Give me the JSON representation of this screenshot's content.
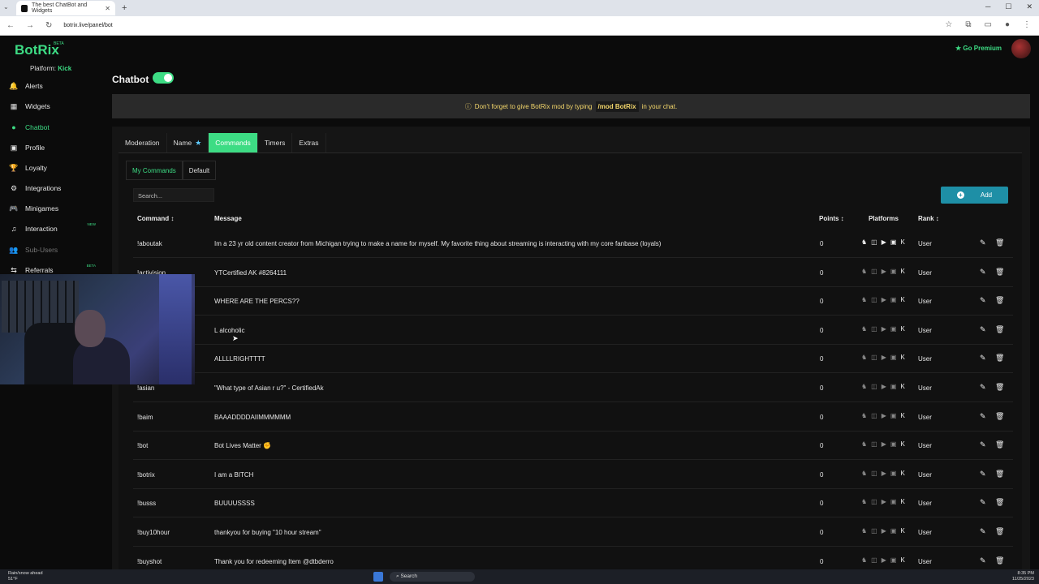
{
  "browser": {
    "tab_title": "The best ChatBot and Widgets",
    "url": "botrix.live/panel/bot"
  },
  "header": {
    "logo": "BotRix",
    "beta": "BETA",
    "platform_label": "Platform:",
    "platform_value": "Kick",
    "go_premium": "Go Premium"
  },
  "sidebar": {
    "items": [
      {
        "label": "Alerts",
        "icon": "bell-icon",
        "glyph": "🔔"
      },
      {
        "label": "Widgets",
        "icon": "widgets-icon",
        "glyph": "▦"
      },
      {
        "label": "Chatbot",
        "icon": "robot-icon",
        "glyph": "●"
      },
      {
        "label": "Profile",
        "icon": "profile-icon",
        "glyph": "▣"
      },
      {
        "label": "Loyalty",
        "icon": "trophy-icon",
        "glyph": "🏆"
      },
      {
        "label": "Integrations",
        "icon": "plug-icon",
        "glyph": "⚙"
      },
      {
        "label": "Minigames",
        "icon": "gamepad-icon",
        "glyph": "🎮"
      },
      {
        "label": "Interaction",
        "icon": "music-icon",
        "glyph": "♫",
        "tag": "NEW"
      },
      {
        "label": "Sub-Users",
        "icon": "users-icon",
        "glyph": "👥"
      },
      {
        "label": "Referrals",
        "icon": "link-icon",
        "glyph": "⇆",
        "tag": "BETA"
      }
    ]
  },
  "main": {
    "title": "Chatbot",
    "notice_prefix": "Don't forget to give BotRix mod by typing",
    "notice_cmd": "/mod BotRix",
    "notice_suffix": "in your chat.",
    "tabs": [
      {
        "label": "Moderation"
      },
      {
        "label": "Name",
        "star": "★"
      },
      {
        "label": "Commands"
      },
      {
        "label": "Timers"
      },
      {
        "label": "Extras"
      }
    ],
    "subtabs": [
      "My Commands",
      "Default"
    ],
    "search_placeholder": "Search...",
    "add_label": "Add",
    "columns": {
      "command": "Command ↕",
      "message": "Message",
      "points": "Points ↕",
      "platforms": "Platforms",
      "rank": "Rank ↕"
    },
    "rows": [
      {
        "command": "!aboutak",
        "message": "Im a 23 yr old content creator from Michigan trying to make a name for myself. My favorite thing about streaming is interacting with my core fanbase (loyals)",
        "points": "0",
        "rank": "User"
      },
      {
        "command": "!activision",
        "message": "YTCertified AK #8264111",
        "points": "0",
        "rank": "User"
      },
      {
        "command": "",
        "message": "WHERE ARE THE PERCS??",
        "points": "0",
        "rank": "User"
      },
      {
        "command": "",
        "message": "L alcoholic",
        "points": "0",
        "rank": "User"
      },
      {
        "command": "",
        "message": "ALLLLRIGHTTTT",
        "points": "0",
        "rank": "User"
      },
      {
        "command": "!asian",
        "message": "\"What type of Asian r u?\" - CertifiedAk",
        "points": "0",
        "rank": "User"
      },
      {
        "command": "!baim",
        "message": "BAAADDDDAIIMMMMMM",
        "points": "0",
        "rank": "User"
      },
      {
        "command": "!bot",
        "message": "Bot Lives Matter ✊",
        "points": "0",
        "rank": "User"
      },
      {
        "command": "!botrix",
        "message": "I am a BITCH",
        "points": "0",
        "rank": "User"
      },
      {
        "command": "!busss",
        "message": "BUUUUSSSS",
        "points": "0",
        "rank": "User"
      },
      {
        "command": "!buy10hour",
        "message": "thankyou for buying \"10 hour stream\"",
        "points": "0",
        "rank": "User"
      },
      {
        "command": "!buyshot",
        "message": "Thank you for redeeming Item @dtbderro",
        "points": "0",
        "rank": "User"
      }
    ]
  },
  "taskbar": {
    "weather_line1": "Rain/snow ahead",
    "weather_line2": "51°F",
    "search": "Search",
    "time": "8:35 PM",
    "date": "11/25/2023"
  },
  "colors": {
    "accent": "#3ddc84",
    "add_button": "#1e8fa6",
    "notice_text": "#f3d66b"
  }
}
